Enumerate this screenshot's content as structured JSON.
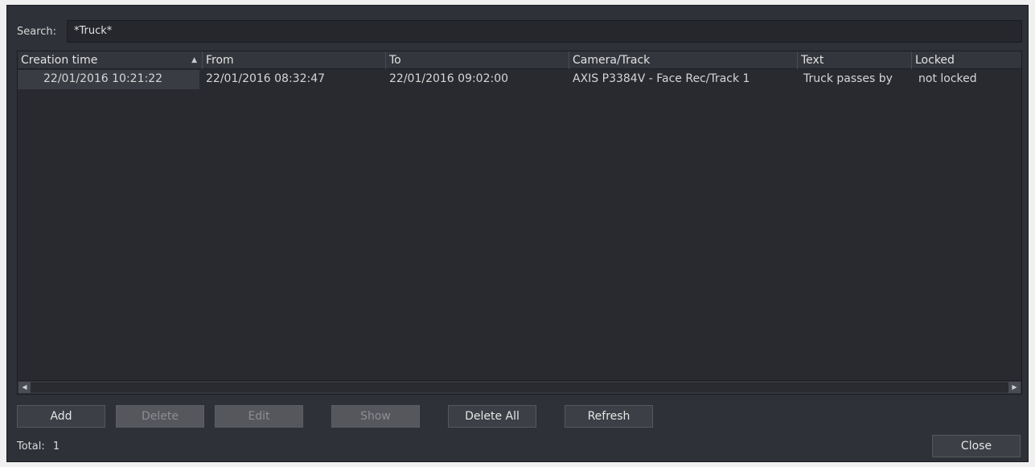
{
  "search": {
    "label": "Search:",
    "value": "*Truck*"
  },
  "table": {
    "columns": [
      "Creation time",
      "From",
      "To",
      "Camera/Track",
      "Text",
      "Locked"
    ],
    "sort_column": "Creation time",
    "sort_direction": "ascending",
    "rows": [
      {
        "creation_time": "22/01/2016 10:21:22",
        "from": "22/01/2016 08:32:47",
        "to": "22/01/2016 09:02:00",
        "camera_track": "AXIS P3384V - Face Rec/Track 1",
        "text": "Truck passes by",
        "locked": "not locked"
      }
    ]
  },
  "buttons": {
    "add": "Add",
    "delete": "Delete",
    "edit": "Edit",
    "show": "Show",
    "delete_all": "Delete All",
    "refresh": "Refresh",
    "close": "Close"
  },
  "footer": {
    "total_label": "Total:",
    "total_value": "1"
  },
  "icons": {
    "sort": "sort-up-icon",
    "scroll_left": "arrow-left-icon",
    "scroll_right": "arrow-right-icon"
  },
  "colors": {
    "background": "#2f3138",
    "text": "#e0e0e0",
    "disabled_button": "#55575d"
  }
}
